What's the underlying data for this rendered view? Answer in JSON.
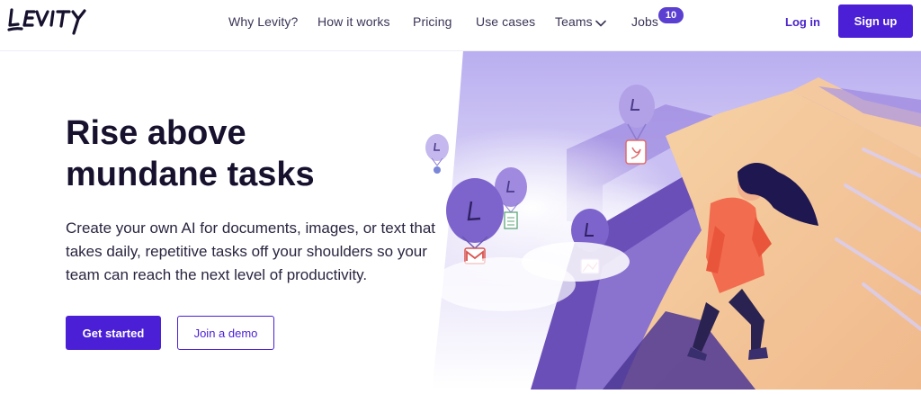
{
  "brand": {
    "name": "LEVITY",
    "accent": "#4a1fd6",
    "dark": "#17112e"
  },
  "nav": {
    "links": [
      "Why Levity?",
      "How it works",
      "Pricing",
      "Use cases",
      "Teams",
      "Jobs"
    ],
    "teams_icon": "chevron-down-icon",
    "jobs_badge": "10",
    "login_label": "Log in",
    "signup_label": "Sign up"
  },
  "hero": {
    "title_line1": "Rise above",
    "title_line2": "mundane tasks",
    "description": "Create your own AI for documents, images, or text that takes daily, repetitive tasks off your shoulders so your team can reach the next level of productivity.",
    "primary_cta": "Get started",
    "secondary_cta": "Join a demo"
  },
  "illustration": {
    "subject": "woman-on-mountain-peak",
    "balloon_icons": [
      "pdf-document-icon",
      "settings-icon",
      "spreadsheet-icon",
      "gmail-icon",
      "image-icon"
    ]
  }
}
